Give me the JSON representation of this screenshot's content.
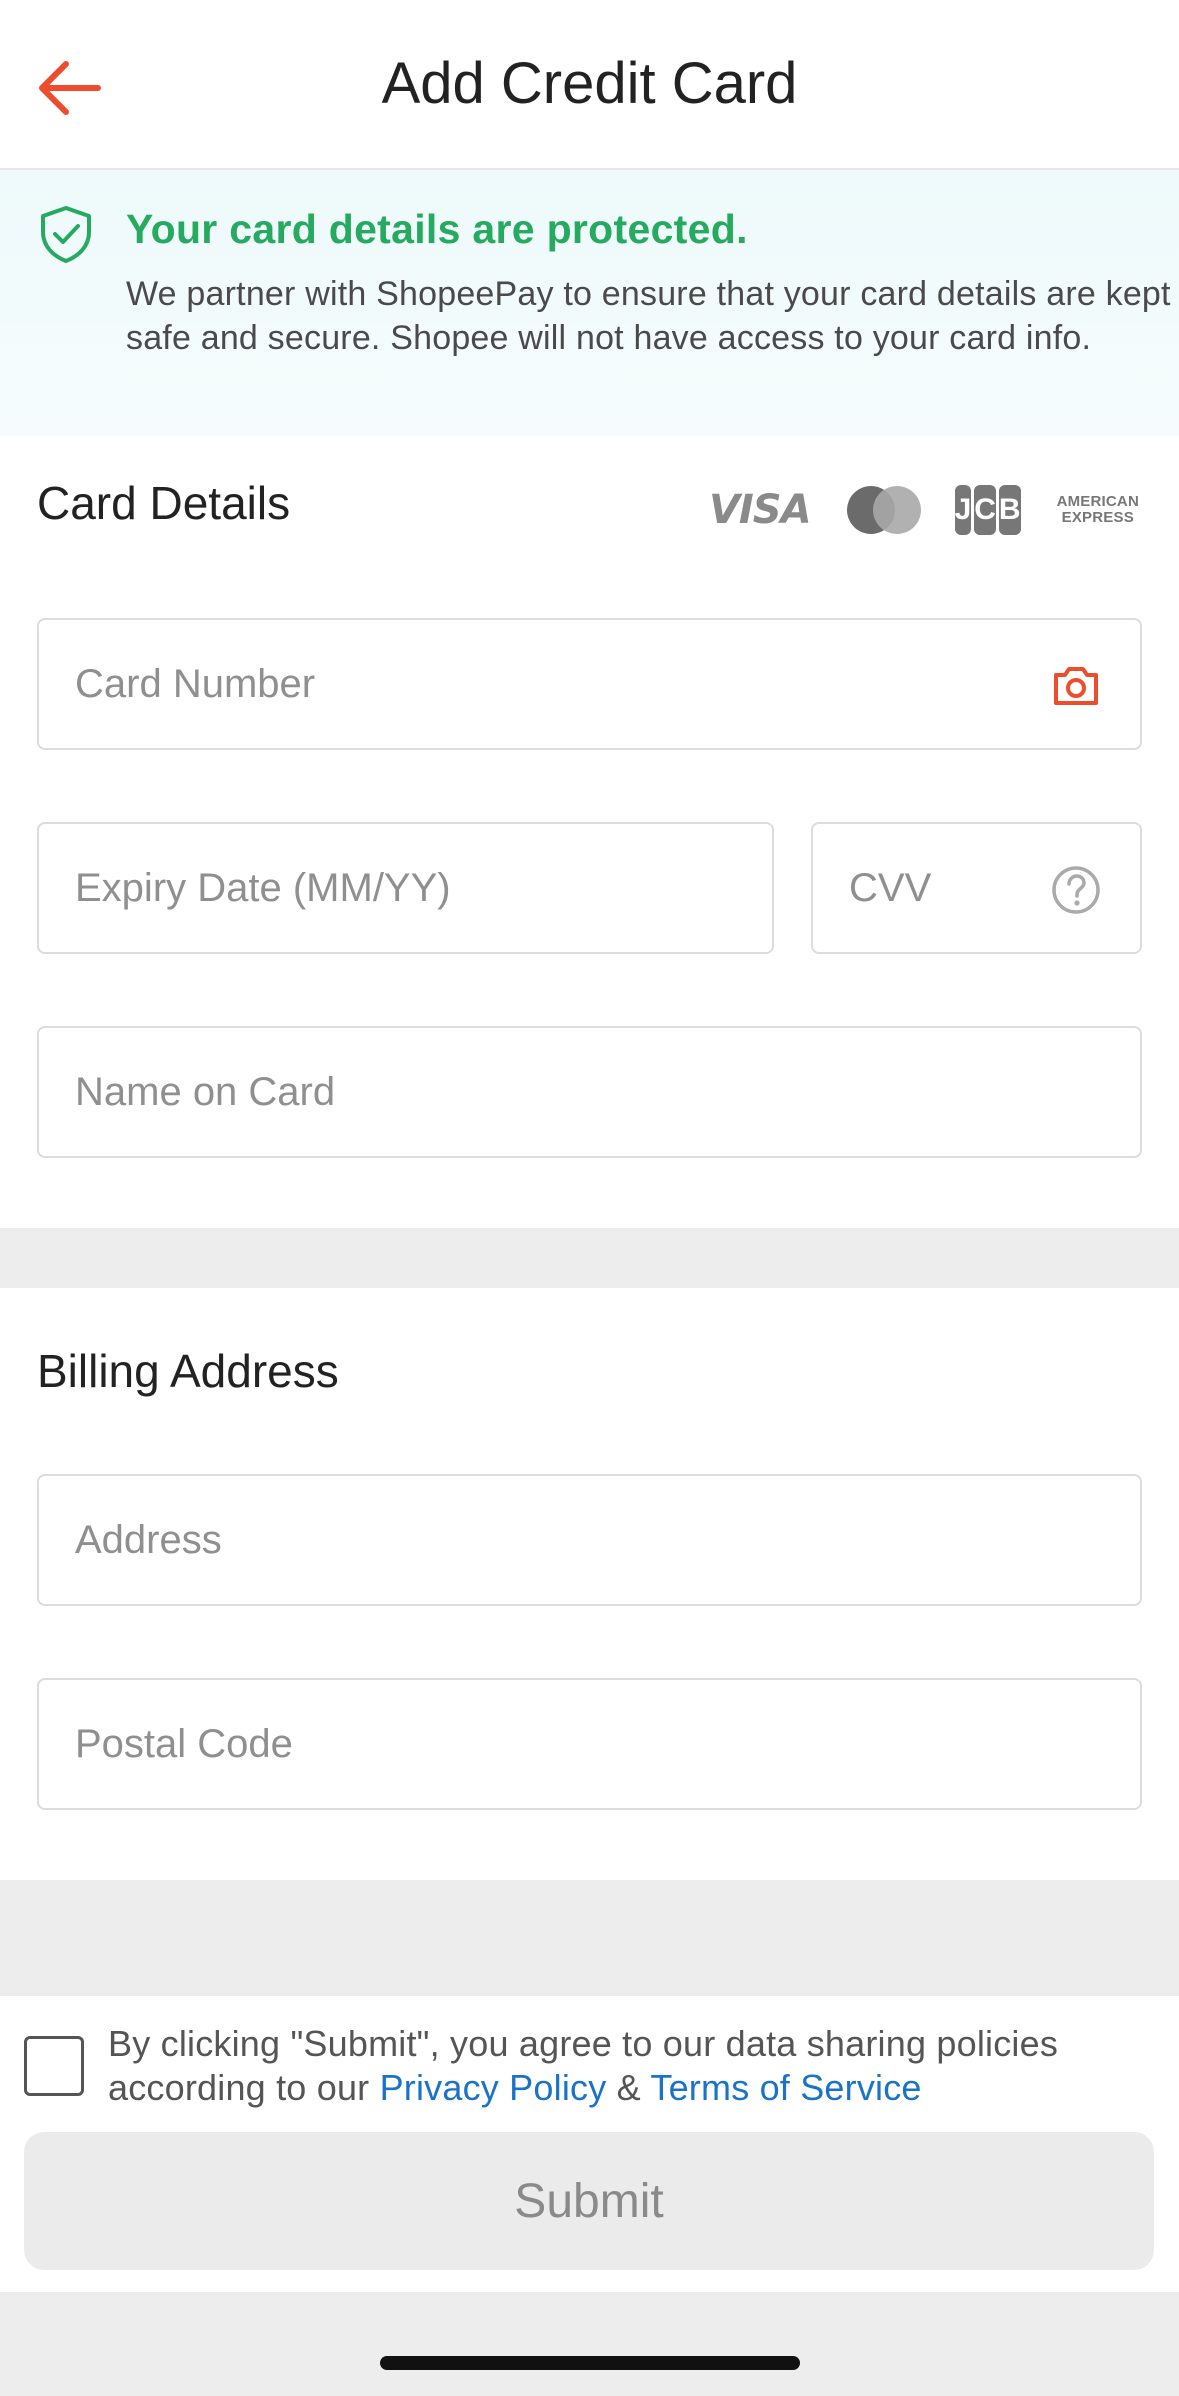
{
  "header": {
    "title": "Add Credit Card",
    "back_icon": "arrow-left-icon",
    "accent": "#ee4d2d"
  },
  "notice": {
    "title": "Your card details are protected.",
    "body": "We partner with ShopeePay to ensure that your card details are kept safe and secure. Shopee will not have access to your card info.",
    "icon": "shield-check-icon",
    "color": "#26aa5f"
  },
  "card_details": {
    "title": "Card Details",
    "brands": {
      "visa": "VISA",
      "jcb": [
        "J",
        "C",
        "B"
      ],
      "amex_line1": "AMERICAN",
      "amex_line2": "EXPRESS"
    },
    "card_number_placeholder": "Card Number",
    "expiry_placeholder": "Expiry Date (MM/YY)",
    "cvv_placeholder": "CVV",
    "name_placeholder": "Name on Card"
  },
  "billing": {
    "title": "Billing Address",
    "address_placeholder": "Address",
    "postal_placeholder": "Postal Code"
  },
  "footer": {
    "agree_prefix": "By clicking \"Submit\", you agree to our data sharing policies according to our ",
    "privacy_link": "Privacy Policy",
    "amp": " & ",
    "terms_link": "Terms of Service",
    "submit_label": "Submit",
    "link_color": "#1a73c9"
  }
}
